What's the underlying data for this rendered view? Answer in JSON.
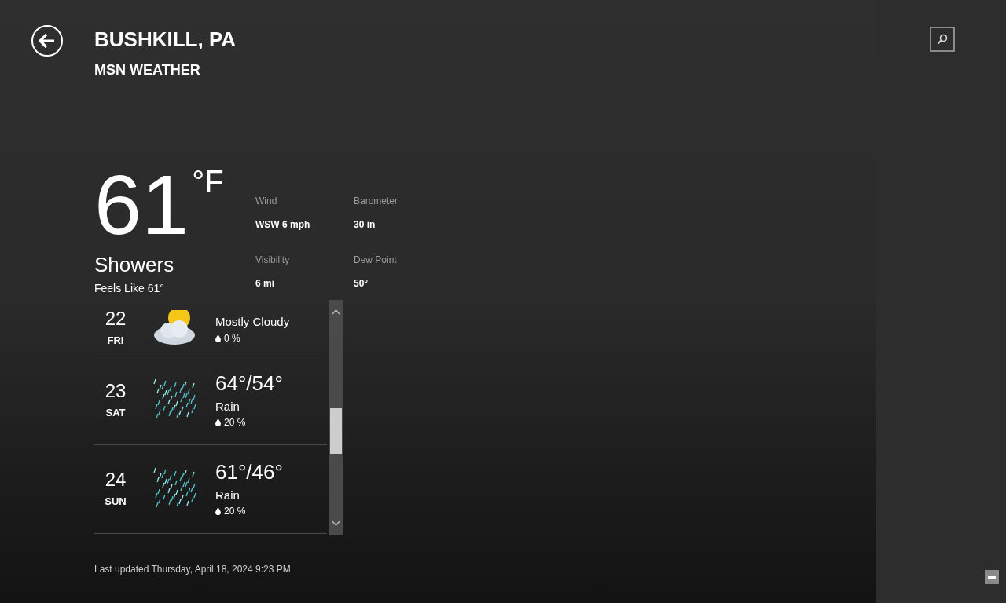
{
  "header": {
    "title": "BUSHKILL, PA",
    "subtitle": "MSN WEATHER"
  },
  "current": {
    "temperature": "61",
    "unit": "°F",
    "condition": "Showers",
    "feels_like": "Feels Like 61°",
    "details": [
      {
        "label": "Wind",
        "value": "WSW 6 mph"
      },
      {
        "label": "Barometer",
        "value": "30 in"
      },
      {
        "label": "Visibility",
        "value": "6 mi"
      },
      {
        "label": "Dew Point",
        "value": "50°"
      }
    ]
  },
  "forecast": [
    {
      "day_number": "22",
      "day": "FRI",
      "kind": "partly-cloudy",
      "condition": "Mostly Cloudy",
      "precip": "0 %"
    },
    {
      "day_number": "23",
      "day": "SAT",
      "kind": "rain",
      "temps": "64°/54°",
      "condition": "Rain",
      "precip": "20 %"
    },
    {
      "day_number": "24",
      "day": "SUN",
      "kind": "rain",
      "temps": "61°/46°",
      "condition": "Rain",
      "precip": "20 %"
    }
  ],
  "footer": "Last updated Thursday, April 18, 2024 9:23 PM"
}
